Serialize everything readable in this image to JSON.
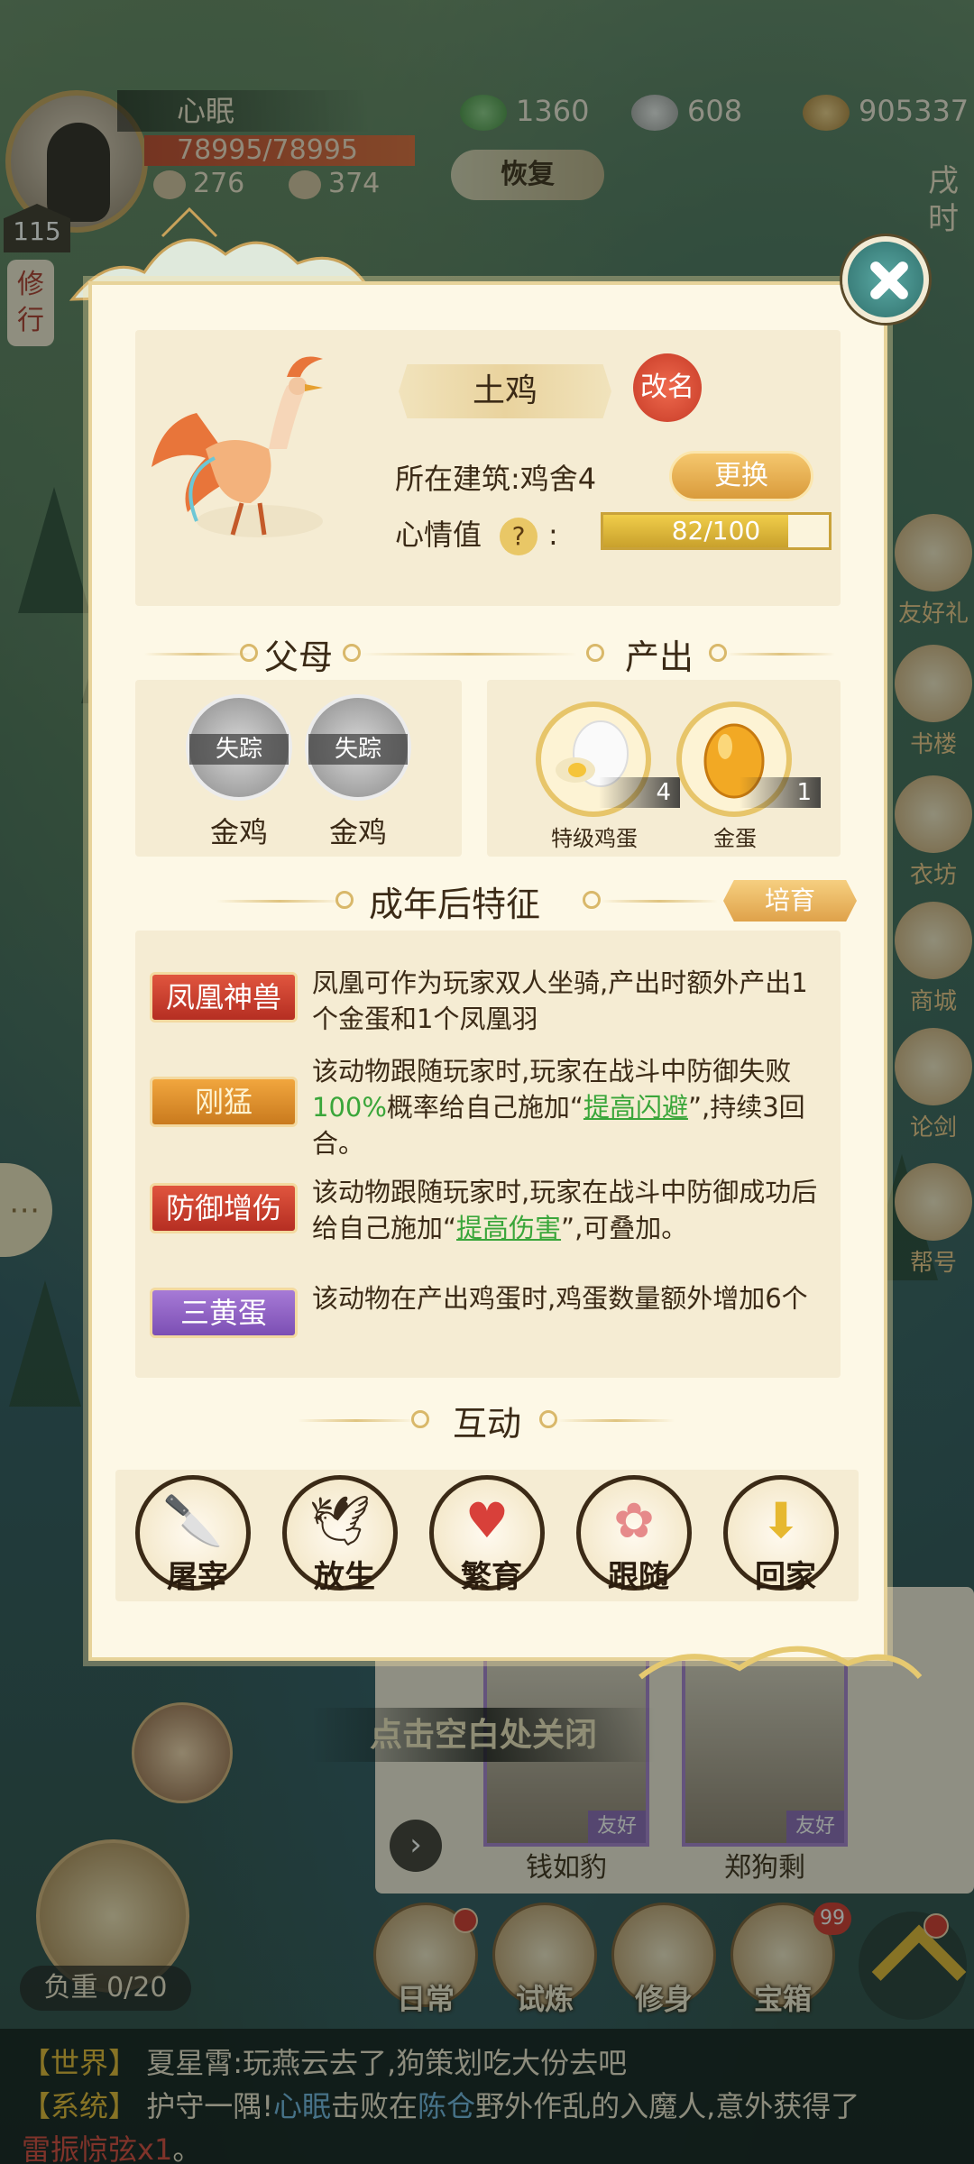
{
  "player": {
    "name": "心眠",
    "level": "115",
    "hp": "78995/78995",
    "stat_a": "276",
    "stat_b": "374"
  },
  "resources": {
    "jade": "1360",
    "silver": "608",
    "coins": "905337"
  },
  "hud": {
    "restore_label": "恢复",
    "time_label": "戌时",
    "cultivate_label": "修行",
    "load_label": "负重 0/20",
    "close_hint": "点击空白处关闭"
  },
  "side_right": [
    {
      "label": "友好礼"
    },
    {
      "label": "书楼"
    },
    {
      "label": "衣坊"
    },
    {
      "label": "商城"
    },
    {
      "label": "论剑"
    },
    {
      "label": "帮号"
    }
  ],
  "npcs": [
    {
      "name": "钱如豹",
      "relation": "友好"
    },
    {
      "name": "郑狗剩",
      "relation": "友好"
    }
  ],
  "bottom_menu": [
    {
      "label": "日常",
      "icon": "calendar-icon"
    },
    {
      "label": "试炼",
      "icon": "sword-icon"
    },
    {
      "label": "修身",
      "icon": "book-icon"
    },
    {
      "label": "宝箱",
      "icon": "chest-icon",
      "badge": "99"
    }
  ],
  "chat": [
    {
      "channel": "【世界】",
      "speaker": "夏星霄",
      "text": ":玩燕云去了,狗策划吃大份去吧"
    },
    {
      "channel": "【系统】",
      "pre": "护守一隅!",
      "hl1": "心眠",
      "mid": "击败在",
      "hl2": "陈仓",
      "post": "野外作乱的入魔人,意外获得了",
      "item": "雷振惊弦x1",
      "end": "。"
    }
  ],
  "animal": {
    "name": "土鸡",
    "rename_label": "改名",
    "building_label": "所在建筑:",
    "building_value": "鸡舍4",
    "change_label": "更换",
    "mood_label": "心情值",
    "mood_colon": ":",
    "mood_value": 82,
    "mood_max": 100,
    "mood_text": "82/100"
  },
  "sections": {
    "parents": "父母",
    "output": "产出",
    "traits": "成年后特征",
    "interact": "互动"
  },
  "parents": [
    {
      "name": "金鸡",
      "status": "失踪"
    },
    {
      "name": "金鸡",
      "status": "失踪"
    }
  ],
  "outputs": [
    {
      "name": "特级鸡蛋",
      "count": "4",
      "icon": "white-egg-icon"
    },
    {
      "name": "金蛋",
      "count": "1",
      "icon": "golden-egg-icon"
    }
  ],
  "breed_label": "培育",
  "traits": [
    {
      "tag": "凤凰神兽",
      "color": "red",
      "desc": "凤凰可作为玩家双人坐骑,产出时额外产出1个金蛋和1个凤凰羽"
    },
    {
      "tag": "刚猛",
      "color": "orange",
      "desc_pre": "该动物跟随玩家时,玩家在战斗中防御失败",
      "desc_pct": "100%",
      "desc_mid": "概率给自己施加“",
      "desc_link": "提高闪避",
      "desc_post": "”,持续3回合。"
    },
    {
      "tag": "防御增伤",
      "color": "red",
      "desc_pre": "该动物跟随玩家时,玩家在战斗中防御成功后给自己施加“",
      "desc_link": "提高伤害",
      "desc_post": "”,可叠加。"
    },
    {
      "tag": "三黄蛋",
      "color": "purple",
      "desc": "该动物在产出鸡蛋时,鸡蛋数量额外增加6个"
    }
  ],
  "interactions": [
    {
      "label": "屠宰",
      "icon": "cleaver-icon"
    },
    {
      "label": "放生",
      "icon": "bird-icon"
    },
    {
      "label": "繁育",
      "icon": "hearts-icon"
    },
    {
      "label": "跟随",
      "icon": "pawprints-icon"
    },
    {
      "label": "回家",
      "icon": "home-arrow-icon"
    }
  ],
  "colors": {
    "modal_bg": "#fdf8e6",
    "card_bg": "#f5ecd3",
    "trait_red": "#c63a26",
    "trait_orange": "#e09a30",
    "trait_purple": "#8c5fc4",
    "highlight_green": "#3aa63a",
    "accent_gold": "#e0c480"
  }
}
